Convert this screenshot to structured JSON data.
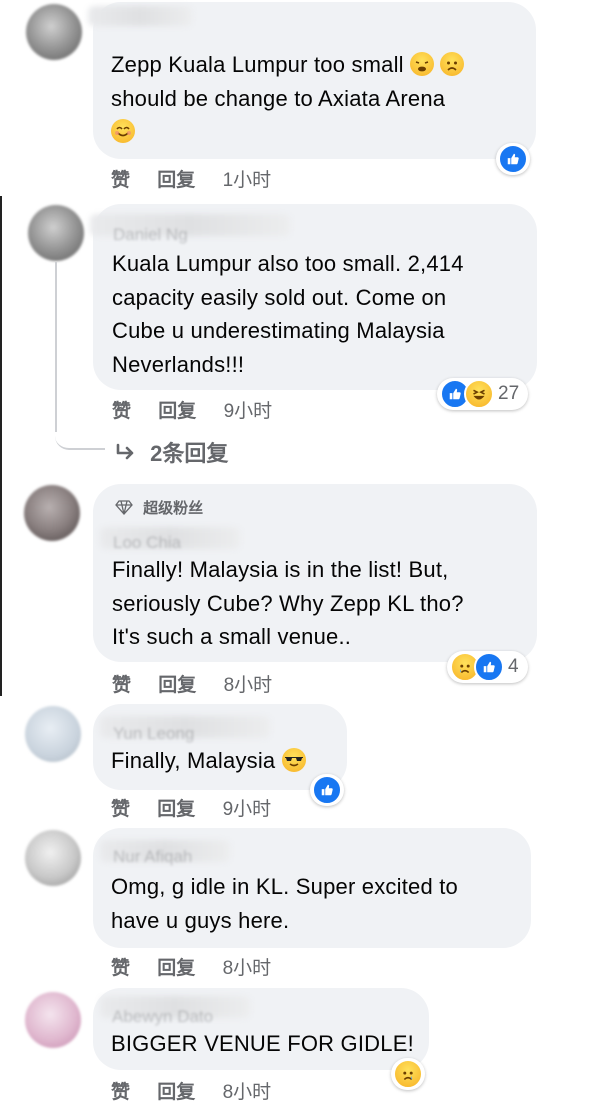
{
  "comments": [
    {
      "text": [
        "Zepp Kuala Lumpur too small",
        "should be change to Axiata Arena"
      ],
      "emojis": [
        "tired-face-emoji",
        "worried-face-emoji",
        "smiling-face-emoji"
      ],
      "actions": {
        "like": "赞",
        "reply": "回复",
        "time": "1小时"
      },
      "reactions": {
        "icons": [
          "like-icon"
        ],
        "count": ""
      }
    },
    {
      "name": "Daniel Ng",
      "text": [
        "Kuala Lumpur also too small. 2,414",
        "capacity easily sold out. Come on",
        "Cube u underestimating Malaysia",
        "Neverlands!!!"
      ],
      "actions": {
        "like": "赞",
        "reply": "回复",
        "time": "9小时"
      },
      "reactions": {
        "icons": [
          "like-icon",
          "haha-icon"
        ],
        "count": "27"
      },
      "replies_link": "2条回复"
    },
    {
      "badge": "超级粉丝",
      "name": "Loo Chia",
      "text": [
        "Finally! Malaysia is in the list! But,",
        "seriously Cube? Why Zepp KL tho?",
        "It's such a small venue.."
      ],
      "actions": {
        "like": "赞",
        "reply": "回复",
        "time": "8小时"
      },
      "reactions": {
        "icons": [
          "sad-icon",
          "like-icon"
        ],
        "count": "4"
      }
    },
    {
      "name": "Yun Leong",
      "text": [
        "Finally, Malaysia"
      ],
      "emojis": [
        "sunglasses-face-emoji"
      ],
      "actions": {
        "like": "赞",
        "reply": "回复",
        "time": "9小时"
      },
      "reactions": {
        "icons": [
          "like-icon"
        ],
        "count": ""
      }
    },
    {
      "name": "Nur Afiqah",
      "text": [
        "Omg, g idle in KL. Super excited to",
        "have u guys here."
      ],
      "actions": {
        "like": "赞",
        "reply": "回复",
        "time": "8小时"
      }
    },
    {
      "name": "Abewyn Dato",
      "text": [
        "BIGGER VENUE FOR GIDLE!"
      ],
      "actions": {
        "like": "赞",
        "reply": "回复",
        "time": "8小时"
      },
      "reactions": {
        "icons": [
          "sad-icon"
        ],
        "count": ""
      }
    }
  ],
  "colors": {
    "bubble": "#f0f2f5",
    "like_blue": "#1877f2",
    "meta_gray": "#65676b",
    "emoji_yellow": "#f7b125"
  }
}
